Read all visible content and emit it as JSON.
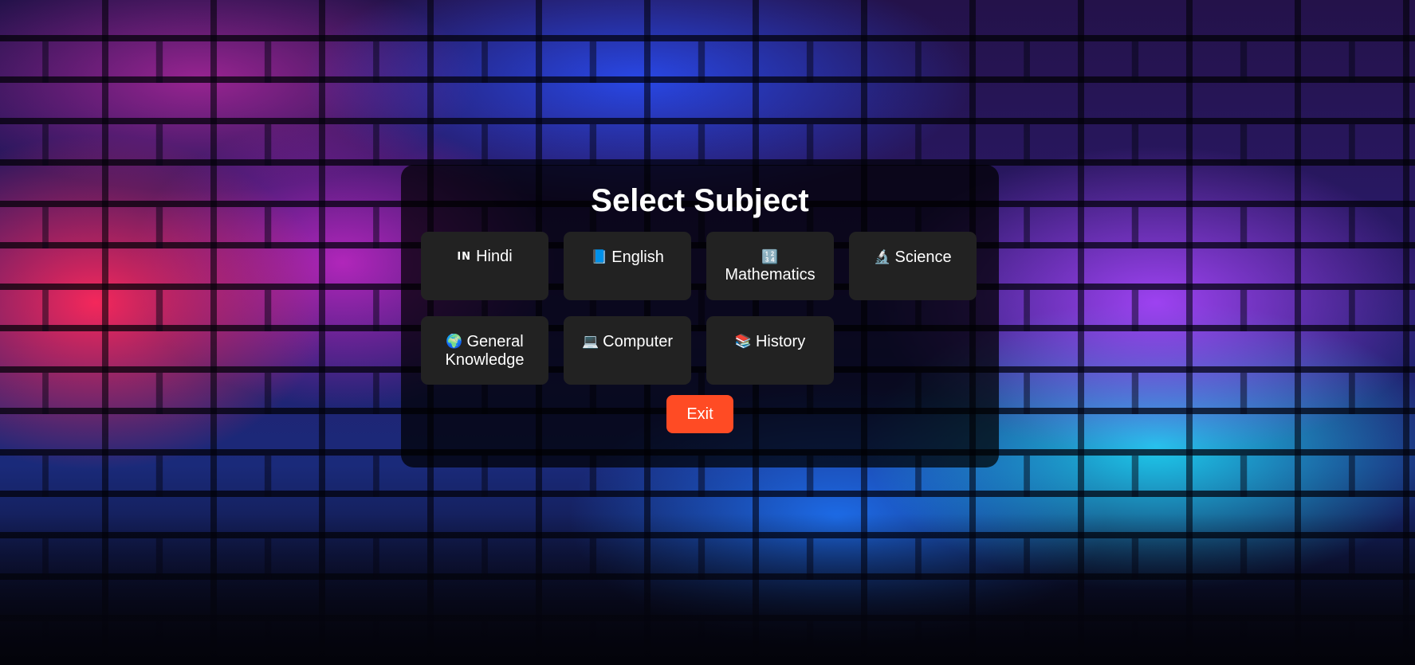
{
  "page": {
    "title": "Select Subject"
  },
  "subjects": [
    {
      "icon": "india-flag-icon",
      "emoji": "IN",
      "label": "Hindi"
    },
    {
      "icon": "blue-book-icon",
      "emoji": "📘",
      "label": "English"
    },
    {
      "icon": "input-numbers-icon",
      "emoji": "🔢",
      "label": "Mathematics"
    },
    {
      "icon": "microscope-icon",
      "emoji": "🔬",
      "label": "Science"
    },
    {
      "icon": "globe-icon",
      "emoji": "🌍",
      "label": "General Knowledge"
    },
    {
      "icon": "laptop-icon",
      "emoji": "💻",
      "label": "Computer"
    },
    {
      "icon": "books-icon",
      "emoji": "📚",
      "label": "History"
    }
  ],
  "actions": {
    "exit_label": "Exit"
  },
  "colors": {
    "panel_bg": "#000000",
    "card_bg": "#222222",
    "exit_bg": "#ff4b24",
    "text": "#ffffff"
  }
}
